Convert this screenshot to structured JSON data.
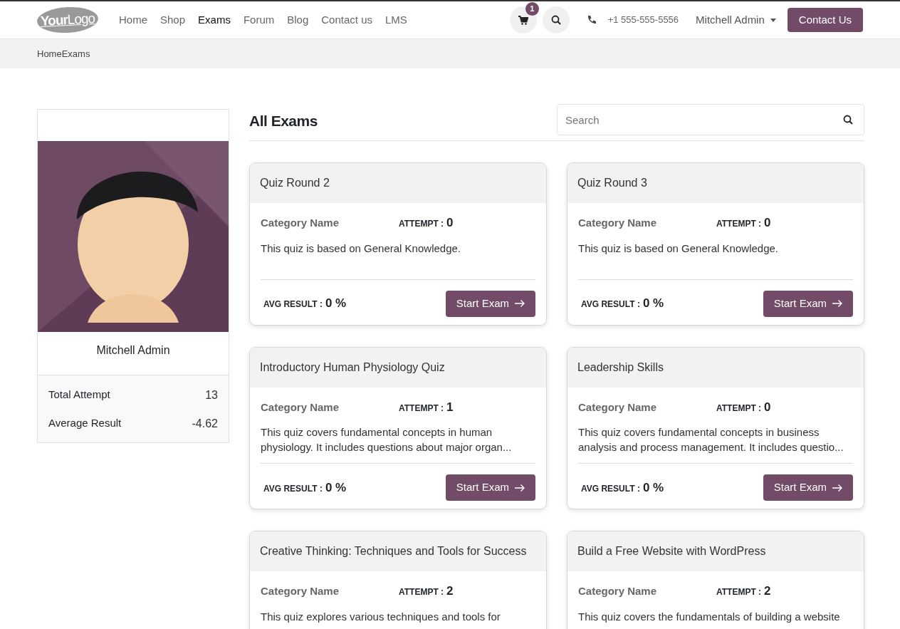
{
  "navbar": {
    "logo": "**Your**Logo",
    "menu": [
      {
        "label": "Home",
        "selected": false
      },
      {
        "label": "Shop",
        "selected": false
      },
      {
        "label": "Exams",
        "selected": true
      },
      {
        "label": "Forum",
        "selected": false
      },
      {
        "label": "Blog",
        "selected": false
      },
      {
        "label": "Contact us",
        "selected": false
      },
      {
        "label": "LMS",
        "selected": false
      }
    ],
    "cart_count": "1",
    "phone": "+1 555-555-5556",
    "user": "Mitchell Admin",
    "cta": "Contact Us"
  },
  "breadcrumb": [
    "Home",
    "Exams"
  ],
  "profile": {
    "name": "Mitchell Admin",
    "stats": [
      {
        "label": "Total Attempt",
        "value": "13"
      },
      {
        "label": "Average Result",
        "value": "-4.62"
      }
    ]
  },
  "exams": {
    "title": "All Exams",
    "search": {
      "placeholder": "Search"
    },
    "cards": [
      {
        "title": "Quiz Round 2",
        "category": "Category Name",
        "attempt_label": "ATTEMPT :",
        "attempt": "0",
        "description": "This quiz is based on General Knowledge.",
        "avg_label": "AVG RESULT :",
        "avg": "0 %",
        "button": "Start Exam"
      },
      {
        "title": "Quiz Round 3",
        "category": "Category Name",
        "attempt_label": "ATTEMPT :",
        "attempt": "0",
        "description": "This quiz is based on General Knowledge.",
        "avg_label": "AVG RESULT :",
        "avg": "0 %",
        "button": "Start Exam"
      },
      {
        "title": "Introductory Human Physiology Quiz",
        "category": "Category Name",
        "attempt_label": "ATTEMPT :",
        "attempt": "1",
        "description": "This quiz covers fundamental concepts in human physiology. It includes questions about major organ...",
        "avg_label": "AVG RESULT :",
        "avg": "0 %",
        "button": "Start Exam"
      },
      {
        "title": "Leadership Skills",
        "category": "Category Name",
        "attempt_label": "ATTEMPT :",
        "attempt": "0",
        "description": "This quiz covers fundamental concepts in business analysis and process management. It includes questio...",
        "avg_label": "AVG RESULT :",
        "avg": "0 %",
        "button": "Start Exam"
      },
      {
        "title": "Creative Thinking: Techniques and Tools for Success",
        "category": "Category Name",
        "attempt_label": "ATTEMPT :",
        "attempt": "2",
        "description": "This quiz explores various techniques and tools for"
      },
      {
        "title": "Build a Free Website with WordPress",
        "category": "Category Name",
        "attempt_label": "ATTEMPT :",
        "attempt": "2",
        "description": "This quiz covers the fundamentals of building a website"
      }
    ]
  }
}
